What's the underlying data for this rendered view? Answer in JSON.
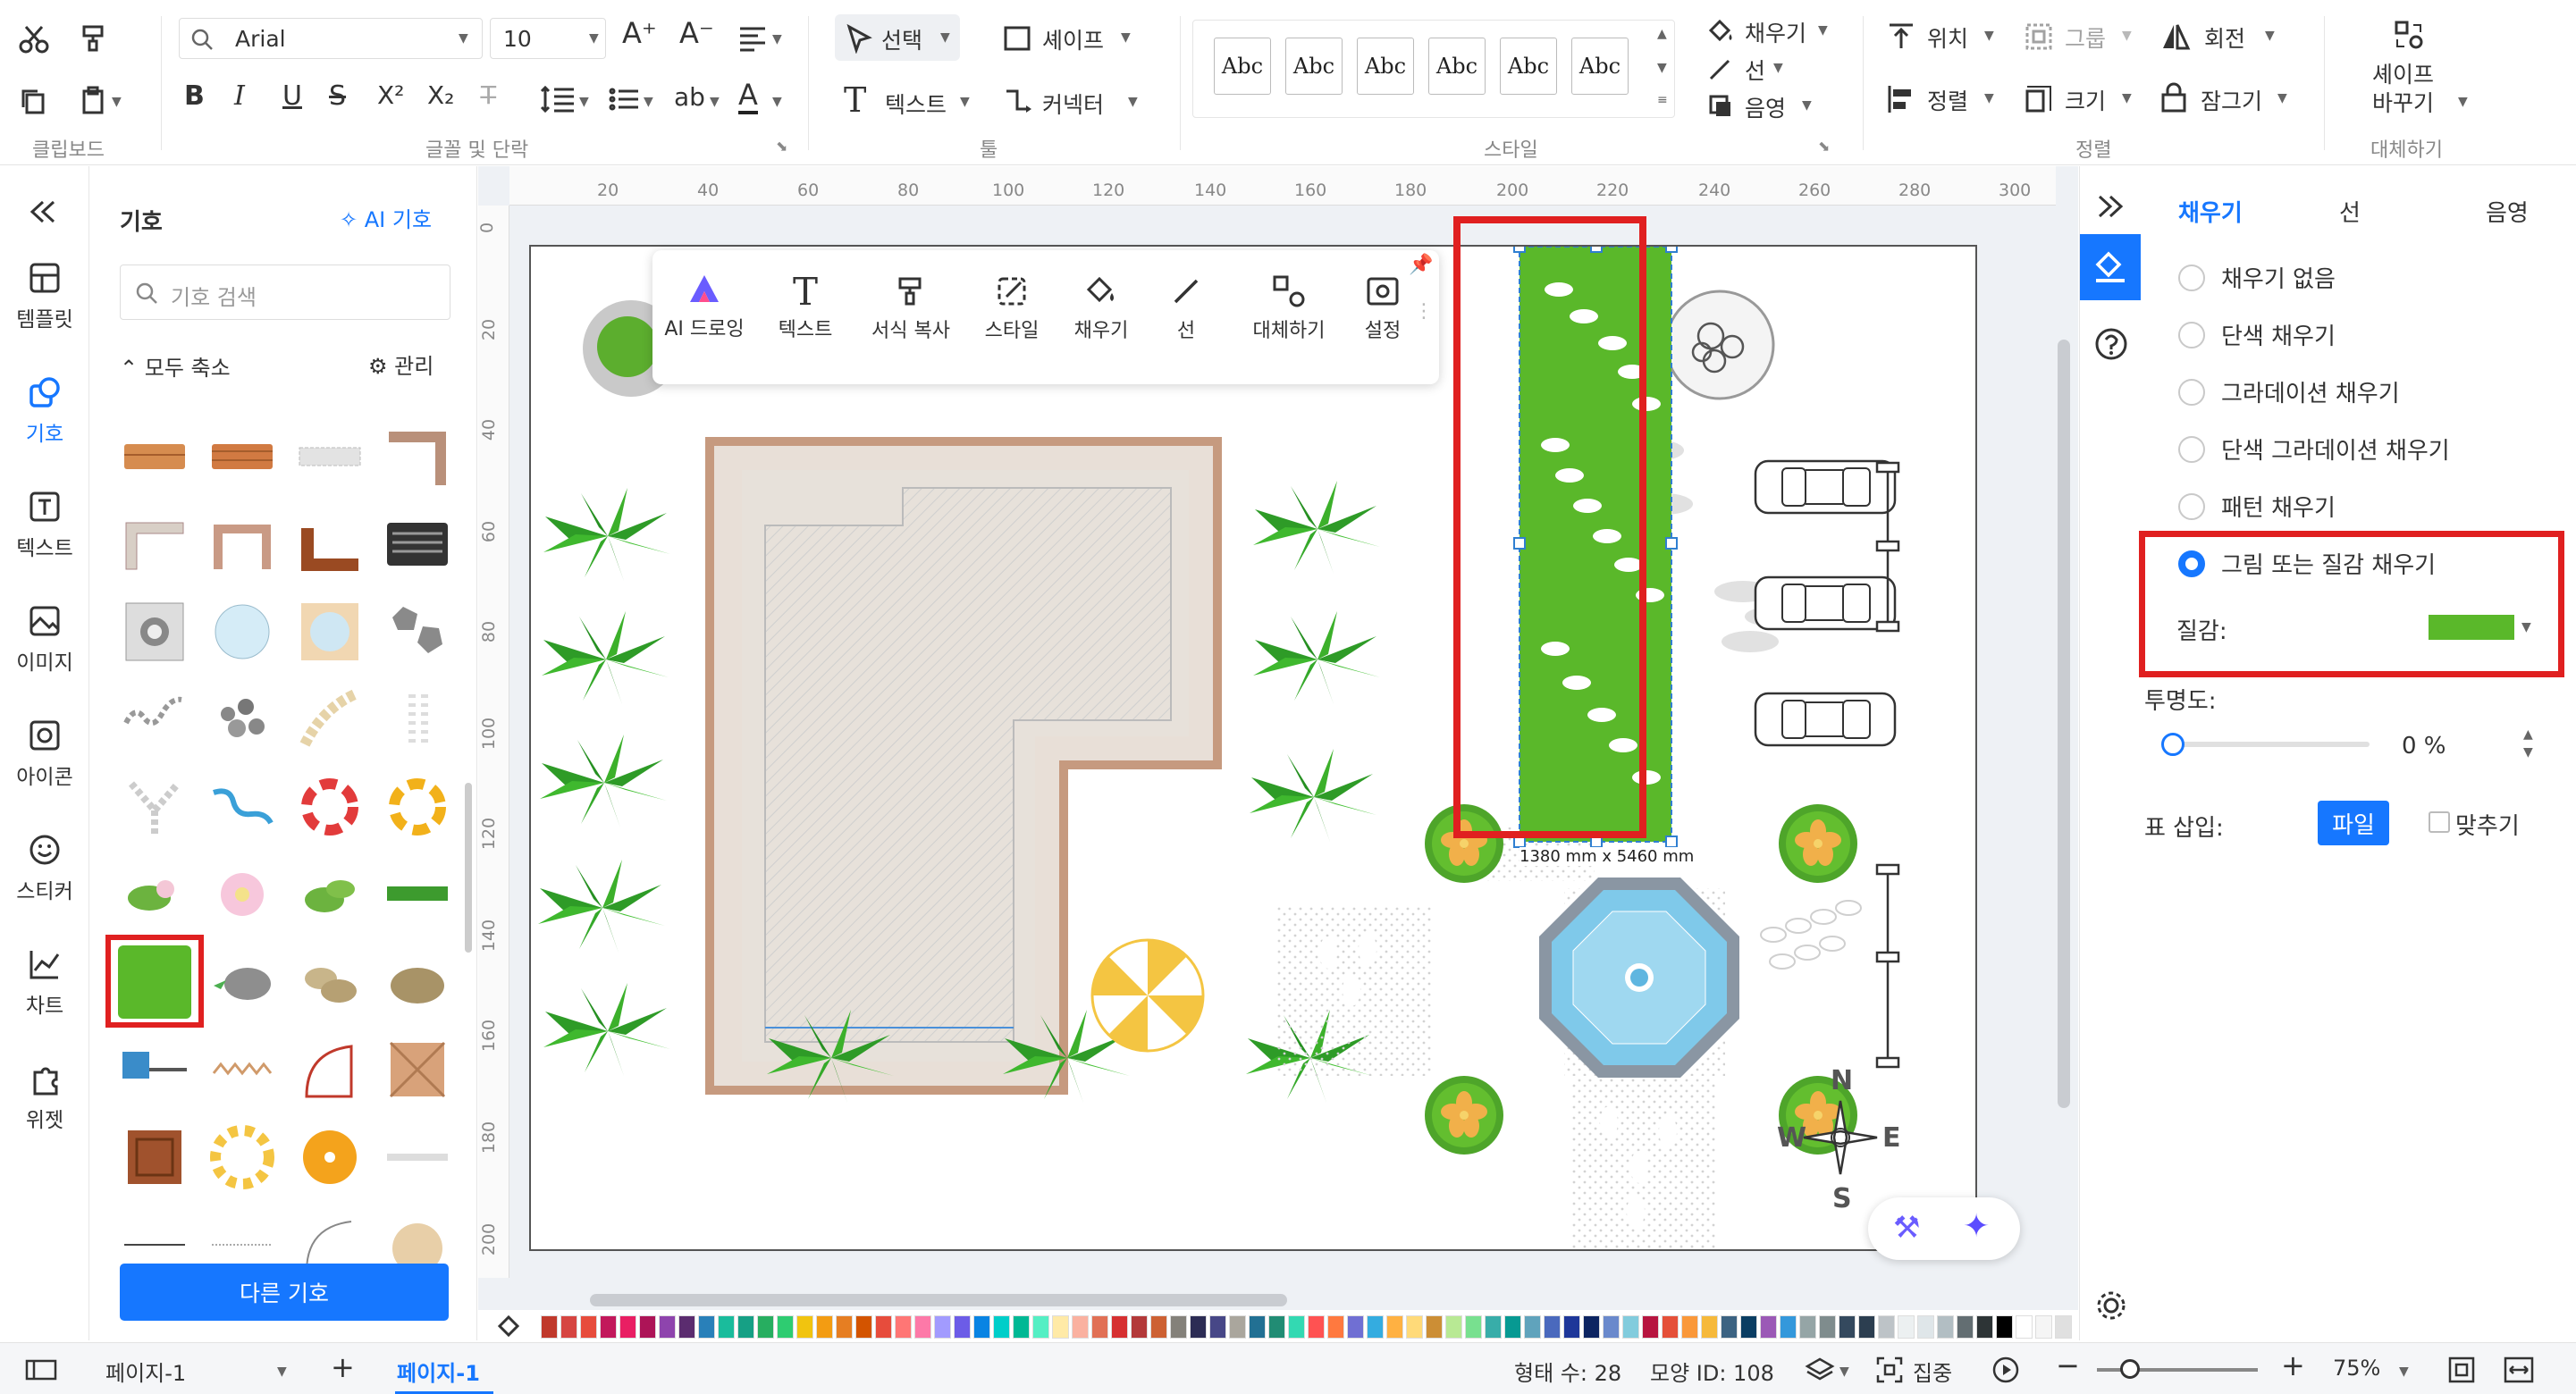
{
  "ribbon": {
    "clipboard_label": "클립보드",
    "font_name": "Arial",
    "font_size": "10",
    "font_group_label": "글꼴 및 단락",
    "select_label": "선택",
    "shape_label": "셰이프",
    "text_label": "텍스트",
    "connector_label": "커넥터",
    "tools_group_label": "툴",
    "style_samples": [
      "Abc",
      "Abc",
      "Abc",
      "Abc",
      "Abc",
      "Abc"
    ],
    "style_group_label": "스타일",
    "fill_label": "채우기",
    "line_label": "선",
    "shadow_label": "음영",
    "position_label": "위치",
    "group_label": "그룹",
    "rotate_label": "회전",
    "align_label": "정렬",
    "size_label": "크기",
    "lock_label": "잠그기",
    "arrange_group_label": "정렬",
    "replace_shape_label_1": "셰이프",
    "replace_shape_label_2": "바꾸기",
    "replace_group_label": "대체하기"
  },
  "leftnav": {
    "items": [
      {
        "label": "템플릿",
        "icon": "template-icon"
      },
      {
        "label": "기호",
        "icon": "symbols-icon",
        "active": true
      },
      {
        "label": "텍스트",
        "icon": "text-icon"
      },
      {
        "label": "이미지",
        "icon": "image-icon"
      },
      {
        "label": "아이콘",
        "icon": "icon-icon"
      },
      {
        "label": "스티커",
        "icon": "sticker-icon"
      },
      {
        "label": "차트",
        "icon": "chart-icon"
      },
      {
        "label": "위젯",
        "icon": "widget-icon"
      }
    ]
  },
  "symbols": {
    "title": "기호",
    "ai_label": "AI 기호",
    "search_placeholder": "기호 검색",
    "collapse_all": "모두 축소",
    "manage": "관리",
    "more_button": "다른 기호"
  },
  "floating_toolbar": {
    "items": [
      "AI 드로잉",
      "텍스트",
      "서식 복사",
      "스타일",
      "채우기",
      "선",
      "대체하기",
      "설정"
    ]
  },
  "canvas": {
    "h_ruler": [
      "20",
      "40",
      "60",
      "80",
      "100",
      "120",
      "140",
      "160",
      "180",
      "200",
      "220",
      "240",
      "260",
      "280",
      "300"
    ],
    "v_ruler": [
      "0",
      "20",
      "40",
      "60",
      "80",
      "100",
      "120",
      "140",
      "160",
      "180",
      "200"
    ],
    "dimension_label": "1380 mm x 5460 mm",
    "compass": {
      "n": "N",
      "s": "S",
      "e": "E",
      "w": "W"
    }
  },
  "right_panel": {
    "tabs": [
      "채우기",
      "선",
      "음영"
    ],
    "fill_options": [
      "채우기 없음",
      "단색 채우기",
      "그라데이션 채우기",
      "단색 그라데이션 채우기",
      "패턴 채우기",
      "그림 또는 질감 채우기"
    ],
    "selected_option": "그림 또는 질감 채우기",
    "texture_label": "질감:",
    "transparency_label": "투명도:",
    "transparency_value": "0 %",
    "transparency_fraction": 0,
    "insert_label": "표 삽입:",
    "file_button": "파일",
    "fit_label": "맞추기"
  },
  "palette": {
    "colors": [
      "#c0392b",
      "#d64541",
      "#e74c3c",
      "#c2185b",
      "#e91e63",
      "#ad1457",
      "#8e44ad",
      "#5b2c6f",
      "#2980b9",
      "#1abc9c",
      "#16a085",
      "#27ae60",
      "#2ecc71",
      "#f1c40f",
      "#f39c12",
      "#e67e22",
      "#d35400",
      "#e74c3c",
      "#ff7675",
      "#fd79a8",
      "#a29bfe",
      "#6c5ce7",
      "#0984e3",
      "#00cec9",
      "#00b894",
      "#55efc4",
      "#ffeaa7",
      "#fab1a0",
      "#e17055",
      "#d63031",
      "#b33939",
      "#cd6133",
      "#84817a",
      "#2c2c54",
      "#474787",
      "#aaa69d",
      "#227093",
      "#218c74",
      "#33d9b2",
      "#ff5252",
      "#ff793f",
      "#706fd3",
      "#34ace0",
      "#ffb142",
      "#ffda79",
      "#cc8e35",
      "#b8e994",
      "#78e08f",
      "#38ada9",
      "#079992",
      "#60a3bc",
      "#4a69bd",
      "#1e3799",
      "#0c2461",
      "#6a89cc",
      "#82ccdd",
      "#b71540",
      "#e55039",
      "#fa983a",
      "#f6b93b",
      "#3c6382",
      "#0a3d62",
      "#9b59b6",
      "#3498db",
      "#95a5a6",
      "#7f8c8d",
      "#34495e",
      "#2c3e50",
      "#bdc3c7",
      "#ecf0f1",
      "#dfe6e9",
      "#b2bec3",
      "#636e72",
      "#2d3436",
      "#000000",
      "#ffffff",
      "#f5f5f5",
      "#e0e0e0"
    ]
  },
  "status": {
    "page_selector": "페이지-1",
    "page_tab": "페이지-1",
    "shape_count": "형태 수: 28",
    "shape_id": "모양 ID: 108",
    "focus": "집중",
    "zoom": "75%"
  },
  "colors": {
    "accent": "#1677ff",
    "highlight_box": "#e02020",
    "grass": "#5ab82a"
  }
}
